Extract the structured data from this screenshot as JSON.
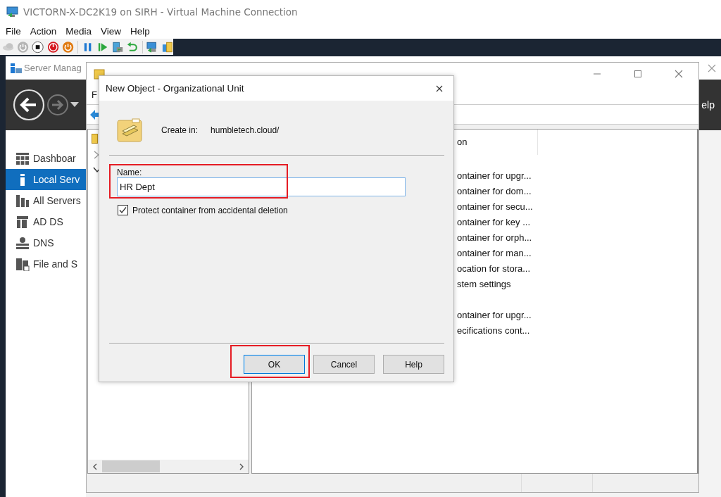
{
  "vm_window": {
    "title": "VICTORN-X-DC2K19 on SIRH - Virtual Machine Connection",
    "menu": [
      "File",
      "Action",
      "Media",
      "View",
      "Help"
    ]
  },
  "server_manager": {
    "title": "Server Manag",
    "header_text": "elp",
    "sidebar": [
      {
        "label": "Dashboar",
        "kind": "dashboard",
        "selected": false
      },
      {
        "label": "Local Serv",
        "kind": "local",
        "selected": true
      },
      {
        "label": "All Servers",
        "kind": "servers",
        "selected": false
      },
      {
        "label": "AD DS",
        "kind": "adds",
        "selected": false
      },
      {
        "label": "DNS",
        "kind": "dns",
        "selected": false
      },
      {
        "label": "File and S",
        "kind": "files",
        "selected": false
      }
    ]
  },
  "aduc": {
    "menu": [
      "F"
    ],
    "table": {
      "columns": [
        "on"
      ],
      "rows": [
        {
          "column_2": "ontainer for upgr..."
        },
        {
          "column_2": "ontainer for dom..."
        },
        {
          "column_2": "ontainer for secu..."
        },
        {
          "column_2": "ontainer for key ..."
        },
        {
          "column_2": "ontainer for orph..."
        },
        {
          "column_2": "ontainer for man..."
        },
        {
          "column_2": "ocation for stora..."
        },
        {
          "column_2": "stem settings"
        },
        {},
        {
          "column_2": "ontainer for upgr..."
        },
        {
          "column_2": "ecifications cont..."
        }
      ]
    }
  },
  "dialog": {
    "title": "New Object - Organizational Unit",
    "create_in_label": "Create in:",
    "create_in_value": "humbletech.cloud/",
    "name_field": {
      "label": "Name:",
      "value": "HR Dept",
      "highlighted": true
    },
    "protect_checkbox": {
      "label": "Protect container from accidental deletion",
      "checked": true
    },
    "buttons": [
      {
        "label": "OK",
        "default": true,
        "highlighted": true
      },
      {
        "label": "Cancel",
        "default": false,
        "highlighted": false
      },
      {
        "label": "Help",
        "default": false,
        "highlighted": false
      }
    ]
  }
}
